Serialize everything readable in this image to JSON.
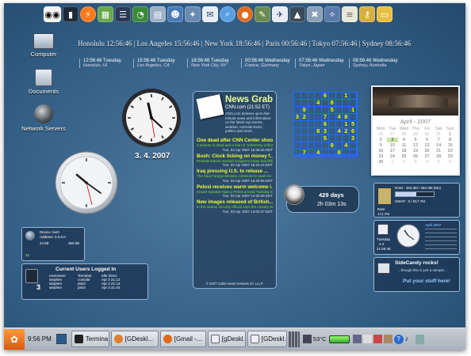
{
  "launcher": {
    "icons": [
      "eyes-icon",
      "terminal-icon",
      "lightning-icon",
      "monitor-icon",
      "list-icon",
      "firefox-fish-icon",
      "file-manager-icon",
      "people-icon",
      "star-icon",
      "mail-icon",
      "search-icon",
      "firefox-icon",
      "gimp-icon",
      "bird-icon",
      "tux-icon",
      "tools-icon",
      "package-icon",
      "notes-icon",
      "keys-icon",
      "folder-icon"
    ]
  },
  "desktop_icons": [
    {
      "label": "Computer",
      "icon": "computer-icon"
    },
    {
      "label": "Documents",
      "icon": "folder-icon"
    },
    {
      "label": "Network Servers",
      "icon": "network-globe-icon"
    }
  ],
  "world_clock": {
    "line": "Honolulu 12:56:46 | Los Angeles 15:56:46 | New York 18:56:46 | Paris 00:56:46 | Tokyo 07:56:46 | Sydney 08:56:46",
    "cities": [
      {
        "time": "12:56:46 Tuesday",
        "place": "Honolulu, HI"
      },
      {
        "time": "15:56:46 Tuesday",
        "place": "Los Angeles, CA"
      },
      {
        "time": "18:56:46 Tuesday",
        "place": "New York City, NY"
      },
      {
        "time": "00:56:46 Wednesday",
        "place": "France, Germany"
      },
      {
        "time": "07:56:46 Wednesday",
        "place": "Tokyo, Japan"
      },
      {
        "time": "08:56:46 Wednesday",
        "place": "Sydney, Australia"
      }
    ]
  },
  "date_label": "3. 4. 2007",
  "news": {
    "title": "News Grab",
    "source": "CNN.com (21:52 ET)",
    "description": "CNN.com delivers up-to-the-minute news and information on the latest top stories, weather, entertainment, politics and more.",
    "items": [
      {
        "headline": "One dead after CNN Center shoo...",
        "body": "A woman is dead and a man is \"extremely critical condition\" after a shooting today at Atlanta's CNN...",
        "date": "Tue, 03 Apr 2007 16:28:25 EDT"
      },
      {
        "headline": "Bush: Clock ticking on money f...",
        "body": "President Bush warned Congress today that failing to quickly send him an acceptable Iraq war funding...",
        "date": "Tue, 03 Apr 2007 15:24:44 EDT"
      },
      {
        "headline": "Iraq pressing U.S. to release ...",
        "body": "The Iraqi Foreign Ministry continued to push for the release of five Iranian detained by U.S...",
        "date": "Tue, 03 Apr 2007 15:26:56 EDT"
      },
      {
        "headline": "Pelosi receives warm welcome i...",
        "body": "House Speaker Nancy Pelosi arrived Tuesday in the Syrian capital, where she is expected to meet wi...",
        "date": "Tue, 03 Apr 2007 14:20:36 EDT"
      },
      {
        "headline": "New images released of British...",
        "body": "In the Iranian security official says the country sees \"no need\" to put 15 seized British sailors and...",
        "date": "Tue, 03 Apr 2007 13:02:37 EDT"
      }
    ],
    "footer": "© 2007 Cable News Network LP, LLLP."
  },
  "sudoku": {
    "cells": [
      "",
      "",
      "",
      "",
      "6",
      "",
      "",
      "1",
      "",
      "",
      "",
      "",
      "4",
      "",
      "8",
      "",
      "",
      "",
      "",
      "9",
      "",
      "",
      "",
      "5",
      "",
      "",
      "1",
      "3",
      "2",
      "",
      "",
      "7",
      "",
      "4",
      "8",
      "",
      "",
      "",
      "",
      "",
      "6",
      "",
      "",
      "1",
      "5",
      "",
      "",
      "",
      "8",
      "3",
      "",
      "4",
      "2",
      "6",
      "",
      "",
      "",
      "",
      "5",
      "",
      "",
      "",
      "3",
      "",
      "",
      "",
      "",
      "",
      "9",
      "",
      "4",
      "",
      "",
      "7",
      "",
      "4",
      "",
      "",
      "8",
      "",
      ""
    ]
  },
  "uptime": {
    "days": "429 days",
    "time": "2h 03m 13s"
  },
  "calendar": {
    "month": "April - 2007",
    "day_names": [
      "Mon",
      "Tue",
      "Wed",
      "Thu",
      "Fri",
      "Sat",
      "Sun"
    ],
    "days": [
      {
        "d": "26",
        "m": true
      },
      {
        "d": "27",
        "m": true
      },
      {
        "d": "28",
        "m": true
      },
      {
        "d": "29",
        "m": true
      },
      {
        "d": "30",
        "m": true
      },
      {
        "d": "31",
        "m": true
      },
      {
        "d": "1"
      },
      {
        "d": "2"
      },
      {
        "d": "3",
        "today": true
      },
      {
        "d": "4"
      },
      {
        "d": "5"
      },
      {
        "d": "6"
      },
      {
        "d": "7"
      },
      {
        "d": "8"
      },
      {
        "d": "9"
      },
      {
        "d": "10"
      },
      {
        "d": "11"
      },
      {
        "d": "12"
      },
      {
        "d": "13"
      },
      {
        "d": "14"
      },
      {
        "d": "15"
      },
      {
        "d": "16"
      },
      {
        "d": "17"
      },
      {
        "d": "18"
      },
      {
        "d": "19"
      },
      {
        "d": "20"
      },
      {
        "d": "21"
      },
      {
        "d": "22"
      },
      {
        "d": "23"
      },
      {
        "d": "24"
      },
      {
        "d": "25"
      },
      {
        "d": "26"
      },
      {
        "d": "27"
      },
      {
        "d": "28"
      },
      {
        "d": "29"
      },
      {
        "d": "30"
      },
      {
        "d": "1",
        "m": true
      },
      {
        "d": "2",
        "m": true
      },
      {
        "d": "3",
        "m": true
      },
      {
        "d": "4",
        "m": true
      },
      {
        "d": "5",
        "m": true
      },
      {
        "d": "6",
        "m": true
      }
    ]
  },
  "system_monitor": {
    "ram": "RAM : 494.3M / 494.3M (Mo)",
    "swap": "SWAP : 0 / 917.7M",
    "label": "Ram",
    "value": "171.7M",
    "ram_level": 0.55
  },
  "mini_calendar": {
    "month": "April 2007",
    "label": "Tuesday",
    "date": "3 4",
    "time": "21:56:46"
  },
  "sidecandy": {
    "title": "SideCandy rocks!",
    "subtitle": "...though this is just a sample...",
    "cta": "Put your stuff here!"
  },
  "device": {
    "line1": "Device: lan0",
    "line2": "Address: 0.0.0.0",
    "rx": "24 kB",
    "tx": "360 kB",
    "num": "22"
  },
  "users": {
    "title": "Current Users Logged In",
    "count": "3",
    "headers": [
      "Username",
      "Terminal",
      "Idle Since"
    ],
    "rows": [
      [
        "stephen",
        "console",
        "Apr 3 21:12"
      ],
      [
        "stephen",
        "pts/3",
        "Apr 3 21:13"
      ],
      [
        "stephen",
        "pts/4",
        "Apr 3 21:44"
      ]
    ]
  },
  "taskbar": {
    "clock": "9:56 PM",
    "tasks": [
      "Termina...",
      "[GDeskl...",
      "[Gmail -...",
      "[gDeskl...",
      "[GDeskl..."
    ],
    "temperature": "53°C"
  }
}
